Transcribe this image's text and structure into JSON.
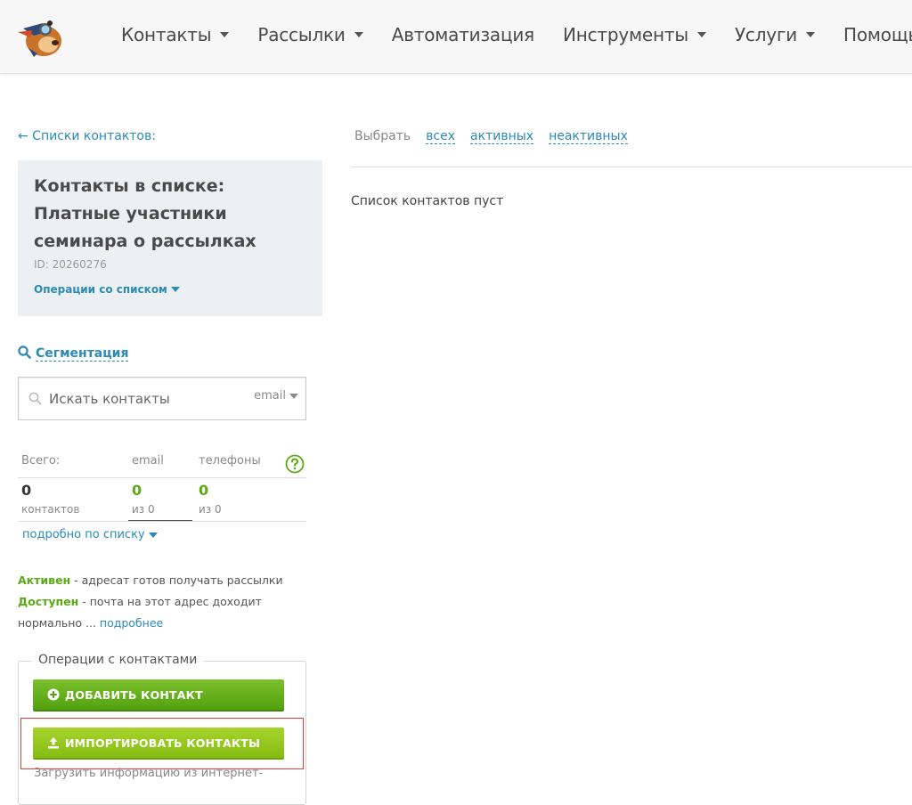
{
  "header": {
    "nav": [
      {
        "label": "Контакты",
        "has_dropdown": true
      },
      {
        "label": "Рассылки",
        "has_dropdown": true
      },
      {
        "label": "Автоматизация",
        "has_dropdown": false
      },
      {
        "label": "Инструменты",
        "has_dropdown": true
      },
      {
        "label": "Услуги",
        "has_dropdown": true
      },
      {
        "label": "Помощь",
        "has_dropdown": true
      }
    ]
  },
  "sidebar": {
    "back_link": "← Списки контактов:",
    "list": {
      "title": "Контакты в списке: Платные участники семинара о рассылках",
      "id": "ID: 20260276",
      "ops_label": "Операции со списком"
    },
    "segmentation_label": "Сегментация",
    "search": {
      "placeholder": "Искать контакты",
      "type": "email"
    },
    "stats": {
      "headers": [
        "Всего:",
        "email",
        "телефоны"
      ],
      "values": [
        {
          "num": "0",
          "sub": "контактов"
        },
        {
          "num": "0",
          "sub": "из 0"
        },
        {
          "num": "0",
          "sub": "из 0"
        }
      ]
    },
    "detail_link": "подробно по списку",
    "legend": {
      "active_term": "Активен",
      "active_desc": " - адресат готов получать рассылки",
      "available_term": "Доступен",
      "available_desc": " - почта на этот адрес доходит нормально ... ",
      "more": "подробнее"
    },
    "contact_ops": {
      "title": "Операции с контактами",
      "add_button": "ДОБАВИТЬ КОНТАКТ",
      "import_button": "ИМПОРТИРОВАТЬ КОНТАКТЫ",
      "description": "Загрузить информацию из интернет-"
    }
  },
  "main": {
    "select_label": "Выбрать",
    "select_options": [
      "всех",
      "активных",
      "неактивных"
    ],
    "empty_message": "Список контактов пуст"
  },
  "colors": {
    "link": "#2a8ab8",
    "green": "#5aaa16",
    "highlight": "#e03c3c"
  }
}
